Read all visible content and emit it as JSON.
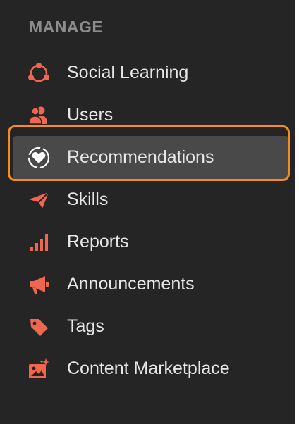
{
  "manage": {
    "heading": "MANAGE",
    "items": [
      {
        "label": "Social Learning",
        "icon": "social-learning-icon",
        "active": false
      },
      {
        "label": "Users",
        "icon": "users-icon",
        "active": false
      },
      {
        "label": "Recommendations",
        "icon": "heart-badge-icon",
        "active": true
      },
      {
        "label": "Skills",
        "icon": "paper-plane-icon",
        "active": false
      },
      {
        "label": "Reports",
        "icon": "bar-chart-icon",
        "active": false
      },
      {
        "label": "Announcements",
        "icon": "megaphone-icon",
        "active": false
      },
      {
        "label": "Tags",
        "icon": "tag-icon",
        "active": false
      },
      {
        "label": "Content Marketplace",
        "icon": "marketplace-image-icon",
        "active": false
      }
    ]
  },
  "colors": {
    "sidebar_bg": "#252525",
    "icon_accent": "#f0674f",
    "active_bg": "#494949",
    "focus_ring": "#f68b1f",
    "label_text": "#e6e6e6",
    "heading_text": "#8c8c8c"
  }
}
